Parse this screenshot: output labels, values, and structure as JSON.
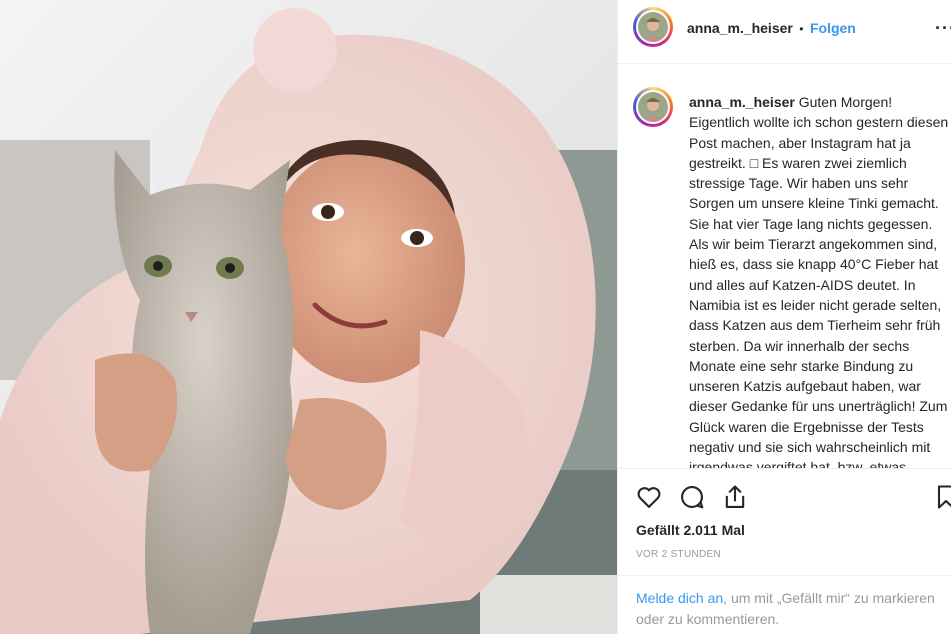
{
  "post": {
    "image_alt": "Selfie einer Frau in rosa Plüsch-Kapuzenjacke mit grau-weißer Katze"
  },
  "header": {
    "username": "anna_m._heiser",
    "separator": "•",
    "follow_label": "Folgen",
    "more_label": "···"
  },
  "caption": {
    "username": "anna_m._heiser",
    "text": "Guten Morgen! Eigentlich wollte ich schon gestern diesen Post machen, aber Instagram hat ja gestreikt. □ Es waren zwei ziemlich stressige Tage. Wir haben uns sehr Sorgen um unsere kleine Tinki gemacht. Sie hat vier Tage lang nichts gegessen. Als wir beim Tierarzt angekommen sind, hieß es, dass sie knapp 40°C Fieber hat und alles auf Katzen-AIDS deutet. In Namibia ist es leider nicht gerade selten, dass Katzen aus dem Tierheim sehr früh sterben. Da wir innerhalb der sechs Monate eine sehr starke Bindung zu unseren Katzis aufgebaut haben, war dieser Gedanke für uns unerträglich! Zum Glück waren die Ergebnisse der Tests negativ und sie sich wahrscheinlich mit irgendwas vergiftet hat, bzw. etwas gegessen hat."
  },
  "actions": {
    "like_icon": "heart-icon",
    "comment_icon": "comment-icon",
    "share_icon": "share-icon",
    "save_icon": "bookmark-icon",
    "likes_text": "Gefällt 2.011 Mal",
    "timestamp": "VOR 2 STUNDEN"
  },
  "login_prompt": {
    "link_text": "Melde dich an",
    "rest_text": ", um mit „Gefällt mir“ zu markieren oder zu kommentieren."
  },
  "colors": {
    "link_blue": "#3897f0",
    "text_dark": "#262626",
    "text_gray": "#999999",
    "border": "#efefef"
  }
}
